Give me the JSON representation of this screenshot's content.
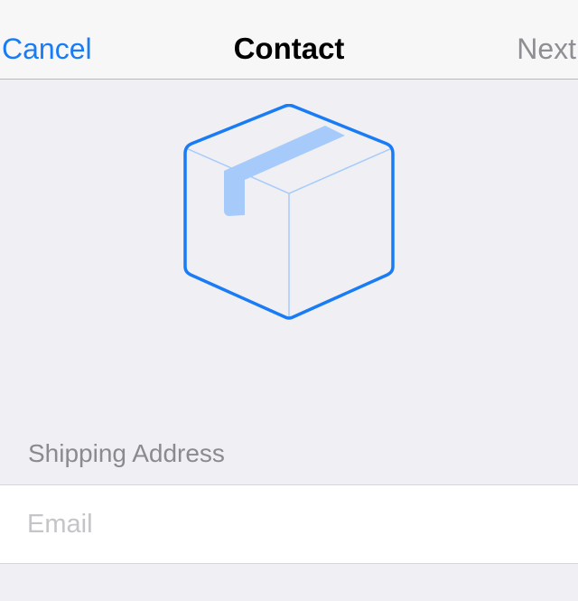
{
  "navbar": {
    "cancel_label": "Cancel",
    "title": "Contact",
    "next_label": "Next"
  },
  "illustration": {
    "icon": "package-box-icon",
    "stroke_color": "#1a7cf5",
    "tape_color": "#a6cbfb"
  },
  "form": {
    "section_header": "Shipping Address",
    "email": {
      "value": "",
      "placeholder": "Email"
    }
  },
  "colors": {
    "accent": "#1a7cf5",
    "disabled": "#8e8e93",
    "background": "#efeff4"
  }
}
